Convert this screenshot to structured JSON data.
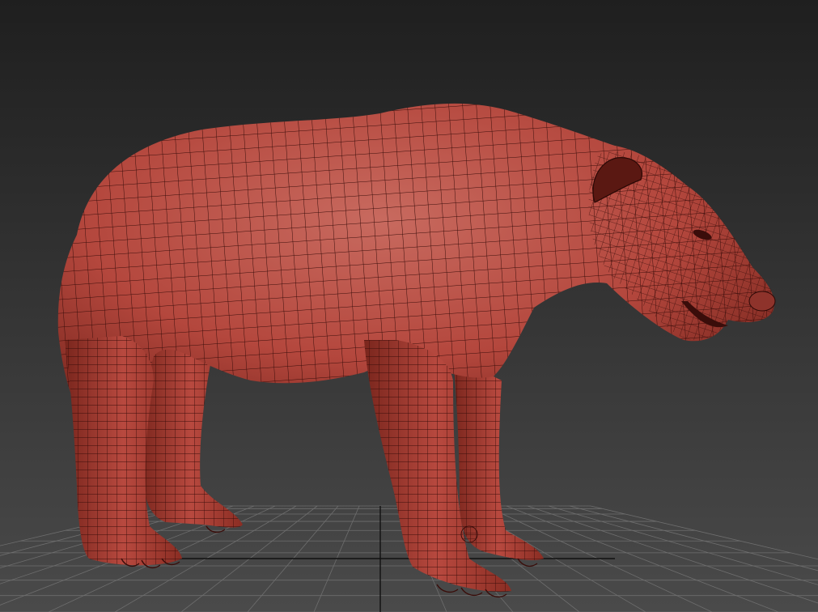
{
  "viewport": {
    "background_top": "#1f1f1f",
    "background_bottom": "#4a4a4a",
    "grid_color": "#6e6e6e",
    "grid_axis_color": "#111111",
    "grid_visible": true
  },
  "model": {
    "subject": "bear-base-mesh",
    "display_mode": "wireframe-on-shaded",
    "skin_color": "#b4473d",
    "skin_highlight": "#c86a5f",
    "skin_shadow": "#6e2018",
    "wire_color": "#3a0d0a"
  }
}
